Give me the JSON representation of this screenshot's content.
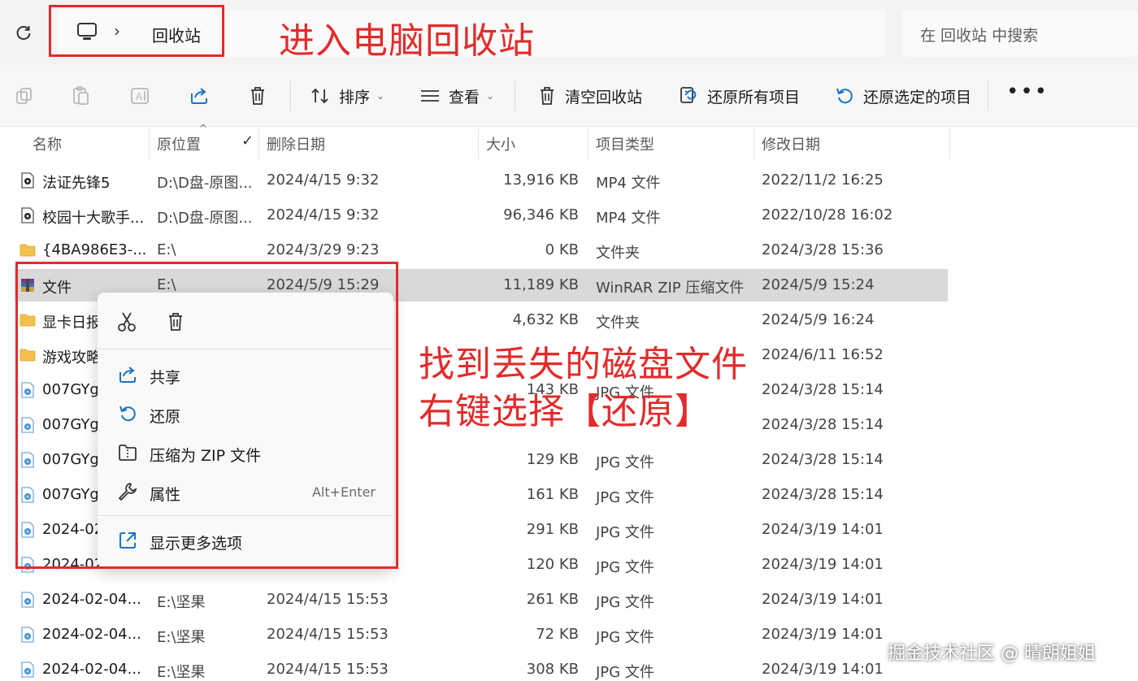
{
  "address": {
    "path_label": "回收站",
    "search_placeholder": "在 回收站 中搜索"
  },
  "annotations": {
    "top": "进入电脑回收站",
    "line1": "找到丢失的磁盘文件",
    "line2": "右键选择【还原】"
  },
  "toolbar": {
    "sort_label": "排序",
    "view_label": "查看",
    "empty_label": "清空回收站",
    "restore_all_label": "还原所有项目",
    "restore_selected_label": "还原选定的项目",
    "more_label": "•••"
  },
  "columns": {
    "name": "名称",
    "location": "原位置",
    "deleted": "删除日期",
    "size": "大小",
    "type": "项目类型",
    "modified": "修改日期"
  },
  "rows": [
    {
      "name": "法证先锋5",
      "location": "D:\\D盘-原图...",
      "deleted": "2024/4/15 9:32",
      "size": "13,916 KB",
      "type": "MP4 文件",
      "modified": "2022/11/2 16:25",
      "icon": "video-file-icon"
    },
    {
      "name": "校园十大歌手...",
      "location": "D:\\D盘-原图...",
      "deleted": "2024/4/15 9:32",
      "size": "96,346 KB",
      "type": "MP4 文件",
      "modified": "2022/10/28 16:02",
      "icon": "video-file-icon"
    },
    {
      "name": "{4BA986E3-...",
      "location": "E:\\",
      "deleted": "2024/3/29 9:23",
      "size": "0 KB",
      "type": "文件夹",
      "modified": "2024/3/28 15:36",
      "icon": "folder-icon"
    },
    {
      "name": "文件",
      "location": "E:\\",
      "deleted": "2024/5/9 15:29",
      "size": "11,189 KB",
      "type": "WinRAR ZIP 压缩文件",
      "modified": "2024/5/9 15:24",
      "icon": "zip-archive-icon"
    },
    {
      "name": "显卡日报",
      "location": "",
      "deleted": "",
      "size": "4,632 KB",
      "type": "文件夹",
      "modified": "2024/5/9 16:24",
      "icon": "folder-icon"
    },
    {
      "name": "游戏攻略",
      "location": "",
      "deleted": "",
      "size": "",
      "type": "",
      "modified": "2024/6/11 16:52",
      "icon": "folder-icon"
    },
    {
      "name": "007GYg",
      "location": "",
      "deleted": "",
      "size": "143 KB",
      "type": "JPG 文件",
      "modified": "2024/3/28 15:14",
      "icon": "image-file-icon"
    },
    {
      "name": "007GYg",
      "location": "",
      "deleted": "",
      "size": "",
      "type": "",
      "modified": "2024/3/28 15:14",
      "icon": "image-file-icon"
    },
    {
      "name": "007GYg",
      "location": "",
      "deleted": "",
      "size": "129 KB",
      "type": "JPG 文件",
      "modified": "2024/3/28 15:14",
      "icon": "image-file-icon"
    },
    {
      "name": "007GYg",
      "location": "",
      "deleted": "",
      "size": "161 KB",
      "type": "JPG 文件",
      "modified": "2024/3/28 15:14",
      "icon": "image-file-icon"
    },
    {
      "name": "2024-02",
      "location": "",
      "deleted": "",
      "size": "291 KB",
      "type": "JPG 文件",
      "modified": "2024/3/19 14:01",
      "icon": "image-file-icon"
    },
    {
      "name": "2024-02",
      "location": "",
      "deleted": "",
      "size": "120 KB",
      "type": "JPG 文件",
      "modified": "2024/3/19 14:01",
      "icon": "image-file-icon"
    },
    {
      "name": "2024-02-04...",
      "location": "E:\\坚果",
      "deleted": "2024/4/15 15:53",
      "size": "261 KB",
      "type": "JPG 文件",
      "modified": "2024/3/19 14:01",
      "icon": "image-file-icon"
    },
    {
      "name": "2024-02-04...",
      "location": "E:\\坚果",
      "deleted": "2024/4/15 15:53",
      "size": "72 KB",
      "type": "JPG 文件",
      "modified": "2024/3/19 14:01",
      "icon": "image-file-icon"
    },
    {
      "name": "2024-02-04...",
      "location": "E:\\坚果",
      "deleted": "2024/4/15 15:53",
      "size": "308 KB",
      "type": "JPG 文件",
      "modified": "2024/3/19 14:01",
      "icon": "image-file-icon"
    }
  ],
  "context_menu": {
    "share": "共享",
    "restore": "还原",
    "compress": "压缩为 ZIP 文件",
    "properties": "属性",
    "properties_shortcut": "Alt+Enter",
    "more_options": "显示更多选项"
  },
  "watermark": "掘金技术社区 @ 晴朗姐姐",
  "colors": {
    "annotation_red": "#e22b2b",
    "accent_blue": "#1a73c8"
  }
}
